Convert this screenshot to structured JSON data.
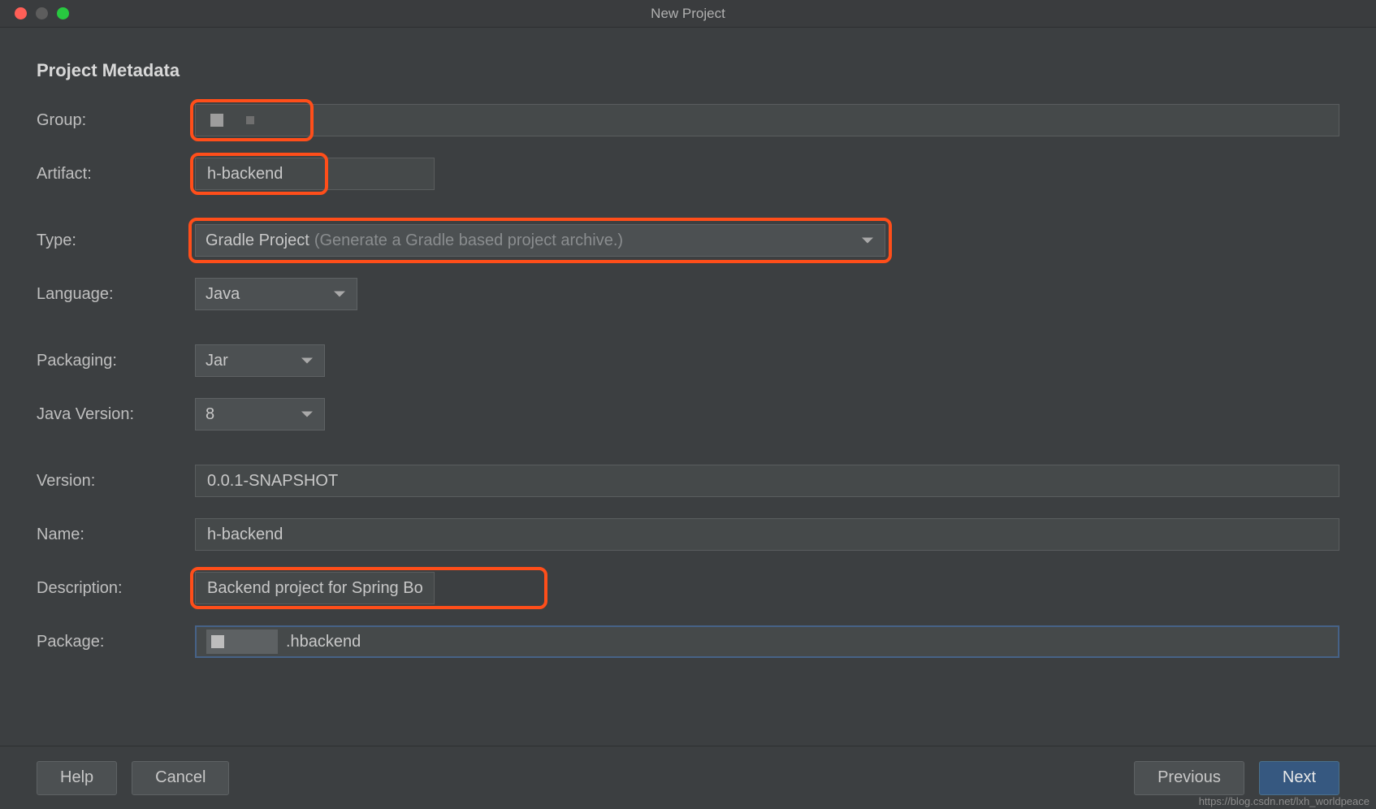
{
  "window": {
    "title": "New Project"
  },
  "section": {
    "title": "Project Metadata"
  },
  "form": {
    "group": {
      "label": "Group:",
      "value": ""
    },
    "artifact": {
      "label": "Artifact:",
      "value": "h-backend"
    },
    "type": {
      "label": "Type:",
      "value": "Gradle Project",
      "hint": "(Generate a Gradle based project archive.)"
    },
    "language": {
      "label": "Language:",
      "value": "Java"
    },
    "packaging": {
      "label": "Packaging:",
      "value": "Jar"
    },
    "javaVersion": {
      "label": "Java Version:",
      "value": "8"
    },
    "version": {
      "label": "Version:",
      "value": "0.0.1-SNAPSHOT"
    },
    "name": {
      "label": "Name:",
      "value": "h-backend"
    },
    "description": {
      "label": "Description:",
      "value": "Backend project for Spring Boot"
    },
    "package": {
      "label": "Package:",
      "value_suffix": ".hbackend"
    }
  },
  "footer": {
    "help": "Help",
    "cancel": "Cancel",
    "previous": "Previous",
    "next": "Next"
  },
  "watermark": "https://blog.csdn.net/lxh_worldpeace"
}
